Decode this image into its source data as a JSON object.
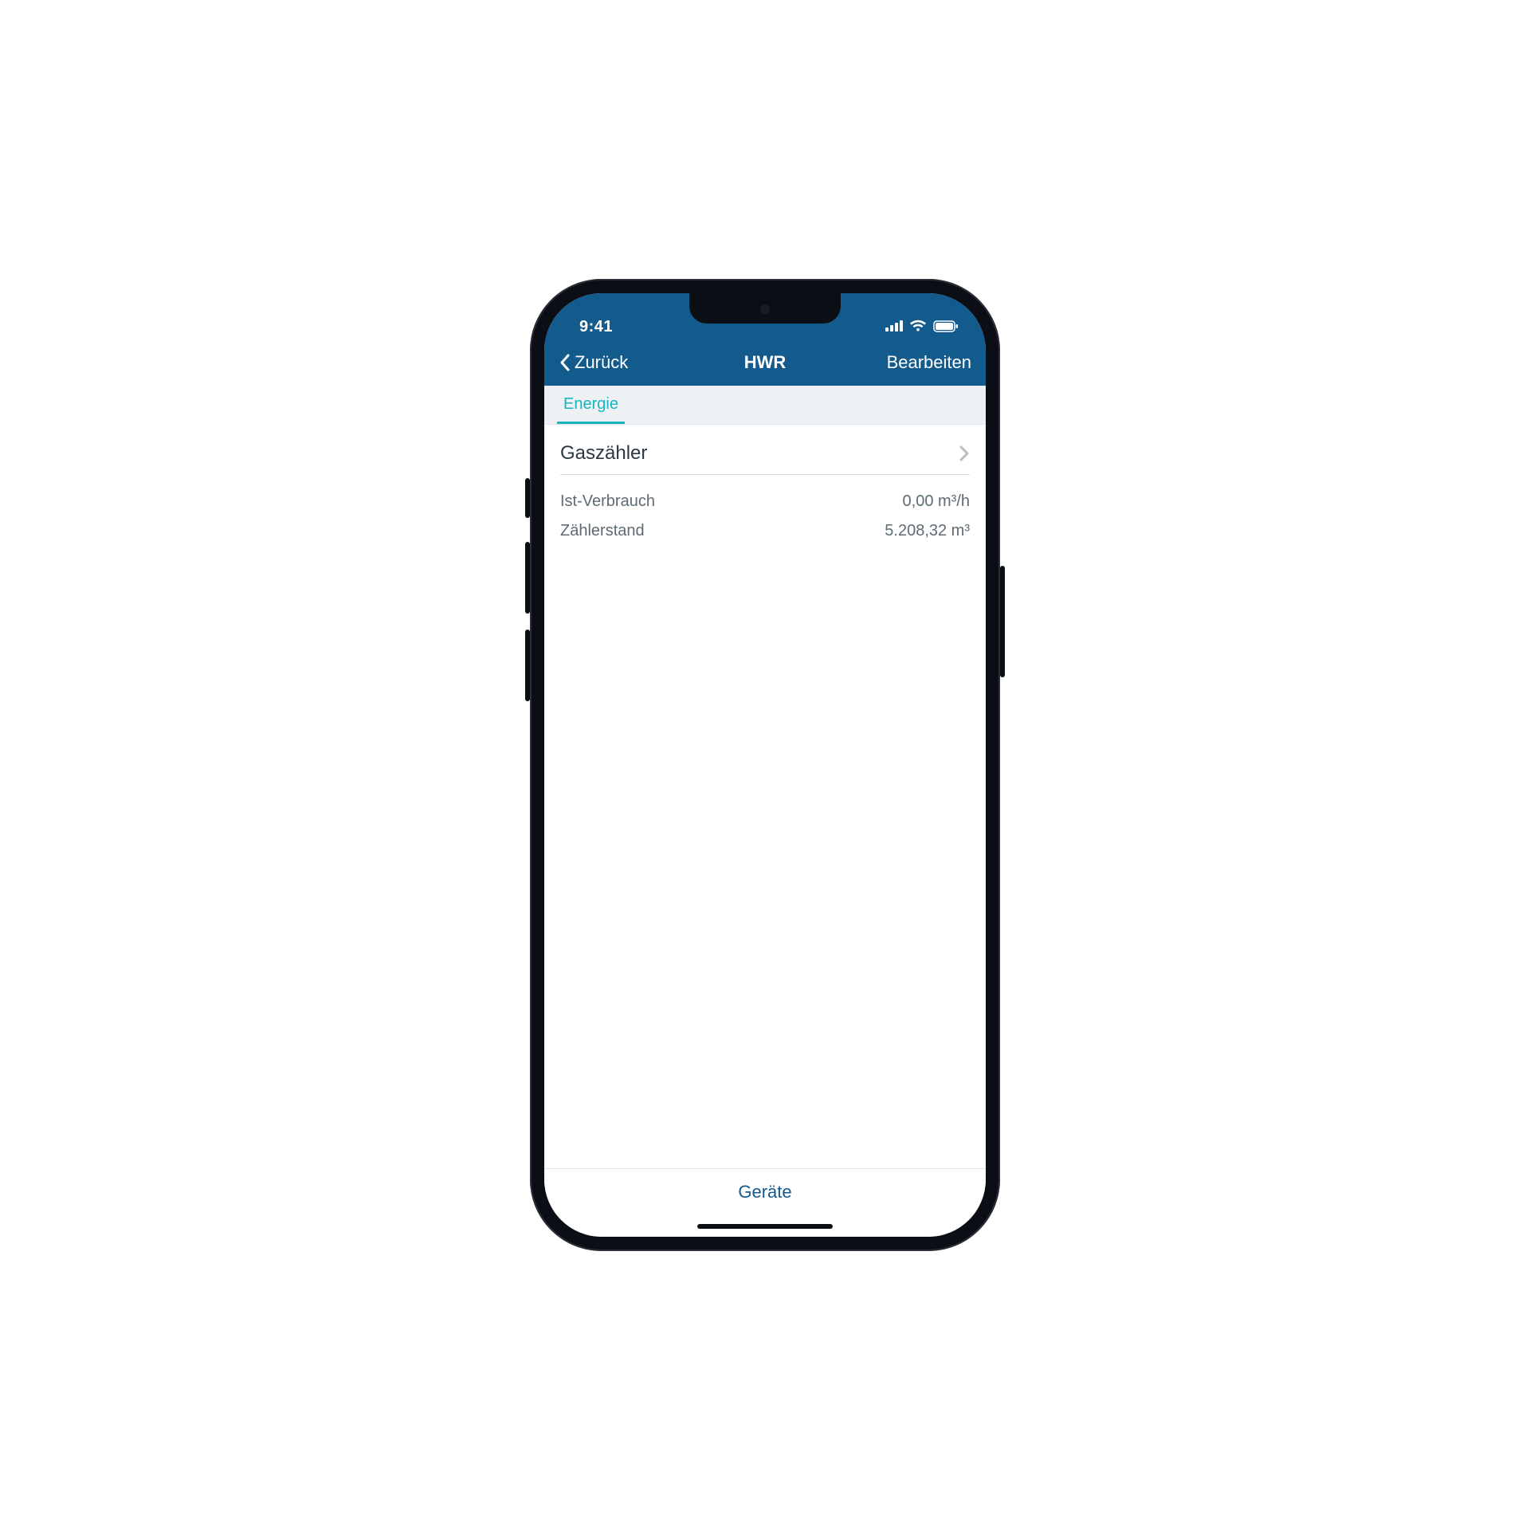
{
  "status": {
    "time": "9:41"
  },
  "nav": {
    "back": "Zurück",
    "title": "HWR",
    "edit": "Bearbeiten"
  },
  "tabs": {
    "energy": "Energie"
  },
  "section": {
    "title": "Gaszähler"
  },
  "metrics": {
    "consumption_label": "Ist-Verbrauch",
    "consumption_value": "0,00 m³/h",
    "reading_label": "Zählerstand",
    "reading_value": "5.208,32 m³"
  },
  "footer": {
    "devices": "Geräte"
  }
}
